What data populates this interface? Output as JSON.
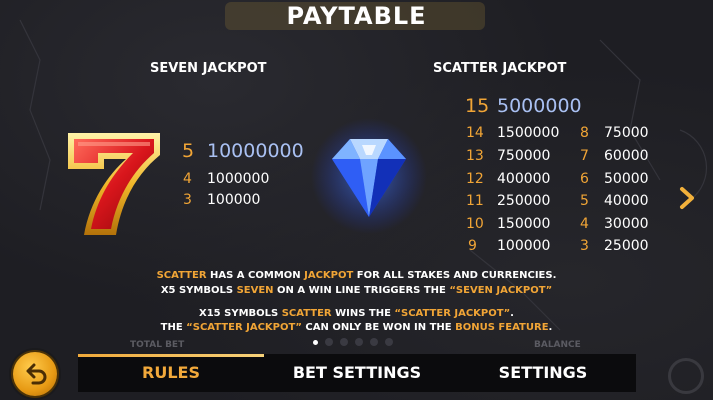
{
  "title": "PAYTABLE",
  "seven": {
    "heading": "SEVEN JACKPOT",
    "rows": [
      {
        "count": "5",
        "value": "10000000"
      },
      {
        "count": "4",
        "value": "1000000"
      },
      {
        "count": "3",
        "value": "100000"
      }
    ]
  },
  "scatter": {
    "heading": "SCATTER JACKPOT",
    "top": {
      "count": "15",
      "value": "5000000"
    },
    "left_rows": [
      {
        "count": "14",
        "value": "1500000"
      },
      {
        "count": "13",
        "value": "750000"
      },
      {
        "count": "12",
        "value": "400000"
      },
      {
        "count": "11",
        "value": "250000"
      },
      {
        "count": "10",
        "value": "150000"
      },
      {
        "count": "9",
        "value": "100000"
      }
    ],
    "right_rows": [
      {
        "count": "8",
        "value": "75000"
      },
      {
        "count": "7",
        "value": "60000"
      },
      {
        "count": "6",
        "value": "50000"
      },
      {
        "count": "5",
        "value": "40000"
      },
      {
        "count": "4",
        "value": "30000"
      },
      {
        "count": "3",
        "value": "25000"
      }
    ]
  },
  "description": {
    "line1": {
      "a": "SCATTER",
      "b": " HAS A COMMON ",
      "c": "JACKPOT",
      "d": " FOR ALL STAKES AND CURRENCIES."
    },
    "line2": {
      "a": "X5 SYMBOLS ",
      "b": "SEVEN",
      "c": " ON A WIN LINE TRIGGERS THE ",
      "d": "“SEVEN JACKPOT”"
    },
    "line3": {
      "a": "X15 SYMBOLS ",
      "b": "SCATTER",
      "c": " WINS THE ",
      "d": "“SCATTER JACKPOT”",
      "e": "."
    },
    "line4": {
      "a": "THE ",
      "b": "“SCATTER JACKPOT”",
      "c": " CAN ONLY BE WON IN THE ",
      "d": "BONUS FEATURE",
      "e": "."
    }
  },
  "pager": {
    "total": 6,
    "active": 0
  },
  "ghost": {
    "total_bet": "TOTAL BET",
    "balance": "BALANCE"
  },
  "tabs": [
    "RULES",
    "BET SETTINGS",
    "SETTINGS"
  ],
  "colors": {
    "accent": "#f1a536",
    "jackpot_blue": "#a9c0f2",
    "tabbar": "#0b0b0d"
  },
  "icons": {
    "back": "back-arrow-icon",
    "next": "chevron-right-icon",
    "settings": "gear-icon"
  }
}
